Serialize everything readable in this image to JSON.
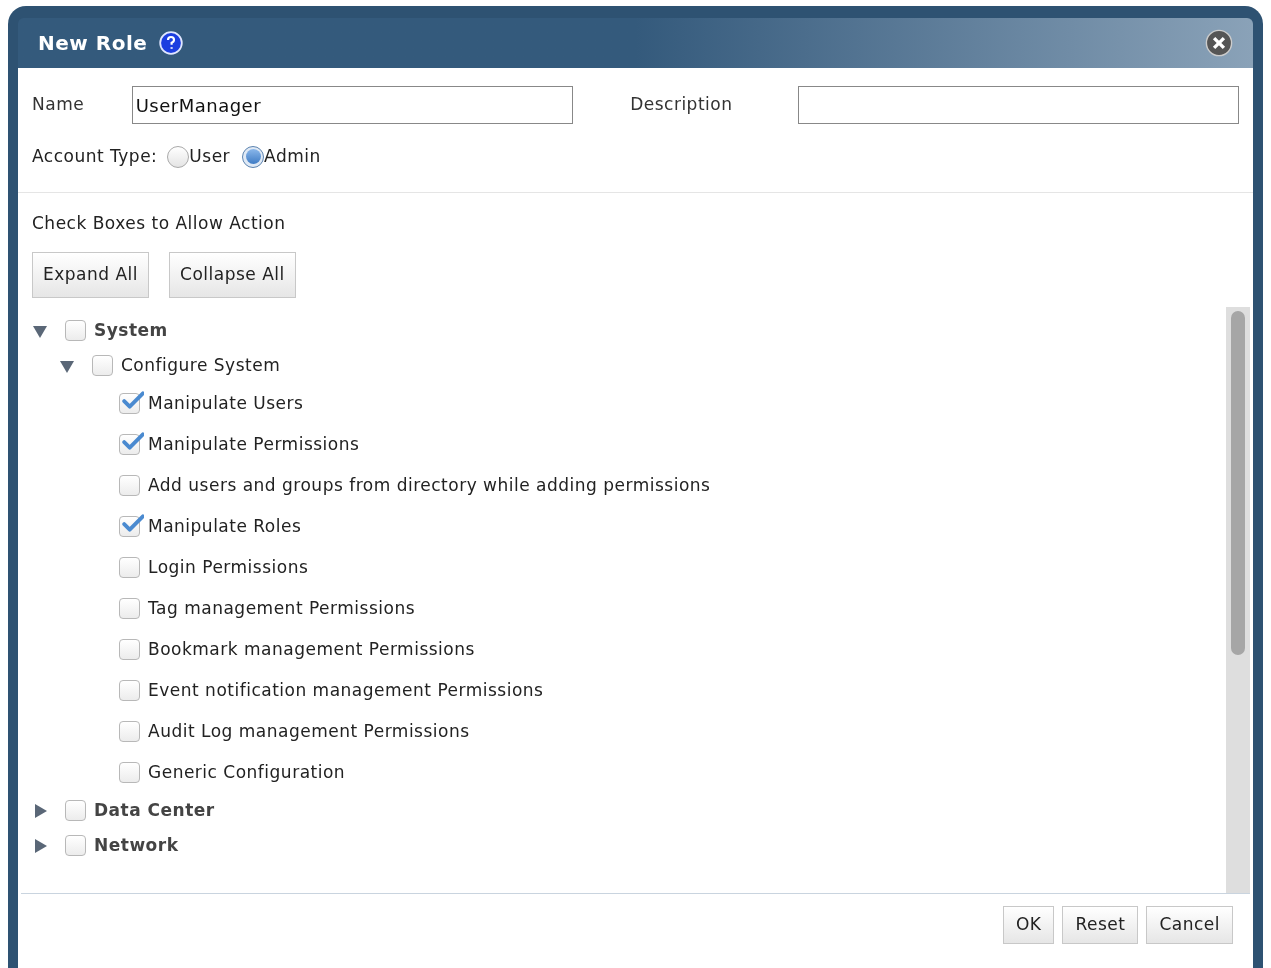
{
  "dialog": {
    "title": "New Role"
  },
  "name_field": {
    "label": "Name",
    "value": "UserManager"
  },
  "description_field": {
    "label": "Description"
  },
  "account_type": {
    "label": "Account Type:",
    "options": [
      {
        "label": "User",
        "selected": false
      },
      {
        "label": "Admin",
        "selected": true
      }
    ]
  },
  "instructions": "Check Boxes to Allow Action",
  "tree_buttons": [
    "Expand All",
    "Collapse All"
  ],
  "tree": [
    {
      "label": "System",
      "expanded": true,
      "checked": false,
      "children": [
        {
          "label": "Configure System",
          "expanded": true,
          "checked": false,
          "children": [
            {
              "label": "Manipulate Users",
              "checked": true
            },
            {
              "label": "Manipulate Permissions",
              "checked": true
            },
            {
              "label": "Add users and groups from directory while adding permissions",
              "checked": false
            },
            {
              "label": "Manipulate Roles",
              "checked": true
            },
            {
              "label": "Login Permissions",
              "checked": false
            },
            {
              "label": "Tag management Permissions",
              "checked": false
            },
            {
              "label": "Bookmark management Permissions",
              "checked": false
            },
            {
              "label": "Event notification management Permissions",
              "checked": false
            },
            {
              "label": "Audit Log management Permissions",
              "checked": false
            },
            {
              "label": "Generic Configuration",
              "checked": false
            }
          ]
        }
      ]
    },
    {
      "label": "Data Center",
      "expanded": false,
      "checked": false
    },
    {
      "label": "Network",
      "expanded": false,
      "checked": false
    }
  ],
  "footer_buttons": [
    "OK",
    "Reset",
    "Cancel"
  ]
}
